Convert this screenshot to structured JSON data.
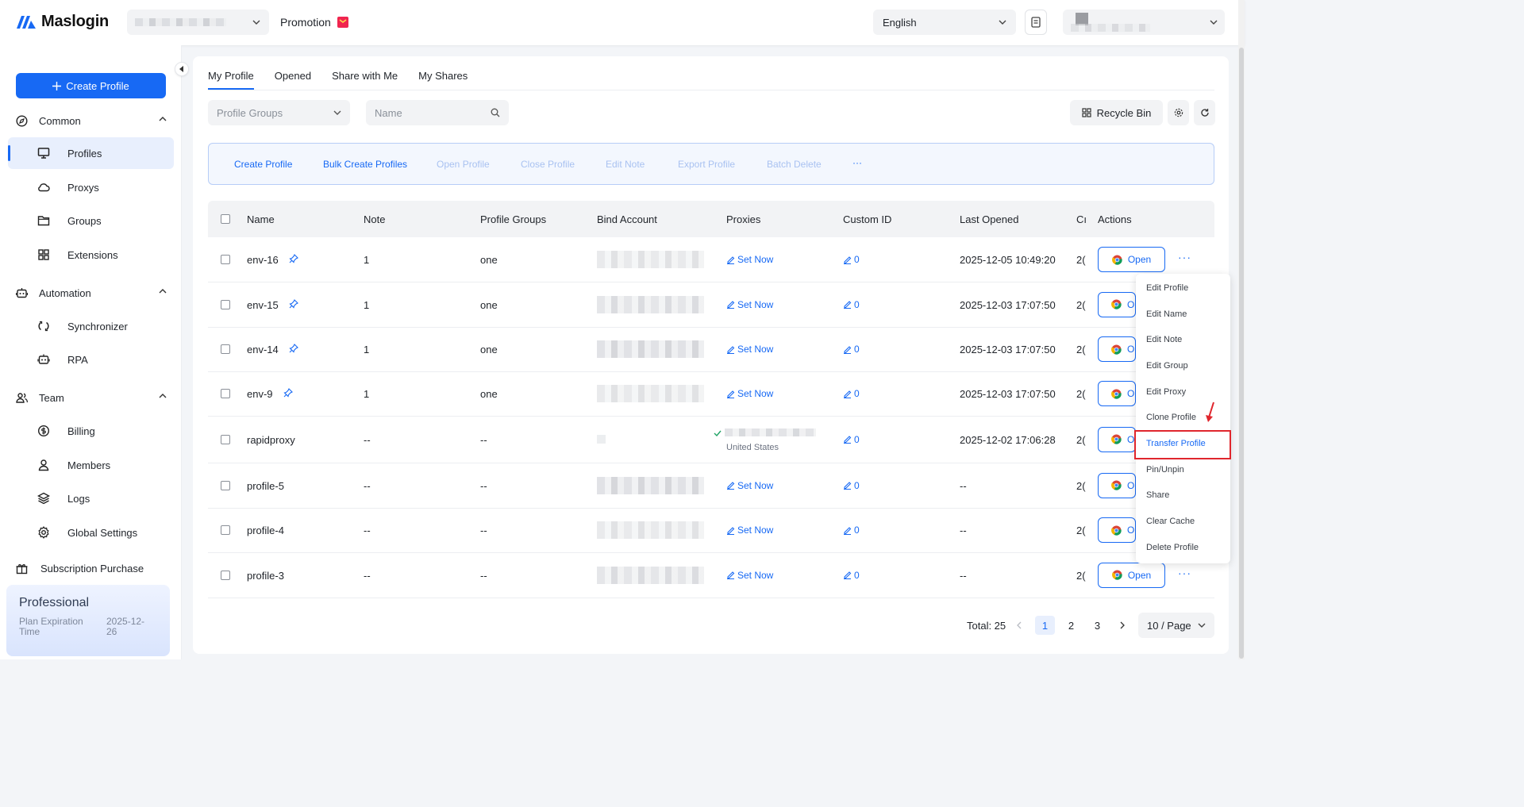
{
  "header": {
    "brand": "Maslogin",
    "promotion_label": "Promotion",
    "language": "English"
  },
  "sidebar": {
    "create_profile": "Create Profile",
    "sections": {
      "common": "Common",
      "automation": "Automation",
      "team": "Team"
    },
    "items": {
      "profiles": "Profiles",
      "proxys": "Proxys",
      "groups": "Groups",
      "extensions": "Extensions",
      "synchronizer": "Synchronizer",
      "rpa": "RPA",
      "billing": "Billing",
      "members": "Members",
      "logs": "Logs",
      "global_settings": "Global Settings"
    },
    "subscription_purchase": "Subscription Purchase",
    "plan": {
      "name": "Professional",
      "expiration_label": "Plan Expiration Time",
      "expiration_value": "2025-12-26"
    }
  },
  "tabs": [
    "My Profile",
    "Opened",
    "Share with Me",
    "My Shares"
  ],
  "filters": {
    "profile_groups_placeholder": "Profile Groups",
    "name_placeholder": "Name",
    "recycle_bin": "Recycle Bin"
  },
  "toolbar": {
    "create_profile": "Create Profile",
    "bulk_create": "Bulk Create Profiles",
    "open_profile": "Open Profile",
    "close_profile": "Close Profile",
    "edit_note": "Edit Note",
    "export_profile": "Export Profile",
    "batch_delete": "Batch Delete",
    "more": "···"
  },
  "table": {
    "columns": {
      "name": "Name",
      "note": "Note",
      "profile_groups": "Profile Groups",
      "bind_account": "Bind Account",
      "proxies": "Proxies",
      "custom_id": "Custom ID",
      "last_opened": "Last Opened",
      "created_truncated": "Cı",
      "actions": "Actions"
    },
    "set_now": "Set Now",
    "open": "Open",
    "open_truncated": "O",
    "created_truncated_value": "2(",
    "rows": [
      {
        "name": "env-16",
        "note": "1",
        "group": "one",
        "proxy": "set",
        "custom_id": "0",
        "last_opened": "2025-12-05 10:49:20"
      },
      {
        "name": "env-15",
        "note": "1",
        "group": "one",
        "proxy": "set",
        "custom_id": "0",
        "last_opened": "2025-12-03 17:07:50"
      },
      {
        "name": "env-14",
        "note": "1",
        "group": "one",
        "proxy": "set",
        "custom_id": "0",
        "last_opened": "2025-12-03 17:07:50"
      },
      {
        "name": "env-9",
        "note": "1",
        "group": "one",
        "proxy": "set",
        "custom_id": "0",
        "last_opened": "2025-12-03 17:07:50"
      },
      {
        "name": "rapidproxy",
        "note": "--",
        "group": "--",
        "proxy": "United States",
        "custom_id": "0",
        "last_opened": "2025-12-02 17:06:28"
      },
      {
        "name": "profile-5",
        "note": "--",
        "group": "--",
        "proxy": "set",
        "custom_id": "0",
        "last_opened": "--"
      },
      {
        "name": "profile-4",
        "note": "--",
        "group": "--",
        "proxy": "set",
        "custom_id": "0",
        "last_opened": "--"
      },
      {
        "name": "profile-3",
        "note": "--",
        "group": "--",
        "proxy": "set",
        "custom_id": "0",
        "last_opened": "--"
      }
    ]
  },
  "context_menu": [
    "Edit Profile",
    "Edit Name",
    "Edit Note",
    "Edit Group",
    "Edit Proxy",
    "Clone Profile",
    "Transfer Profile",
    "Pin/Unpin",
    "Share",
    "Clear Cache",
    "Delete Profile"
  ],
  "pagination": {
    "total": "Total: 25",
    "pages": [
      "1",
      "2",
      "3"
    ],
    "per_page": "10 / Page"
  },
  "colors": {
    "accent": "#1769f4",
    "highlight_border": "#e0262d"
  }
}
